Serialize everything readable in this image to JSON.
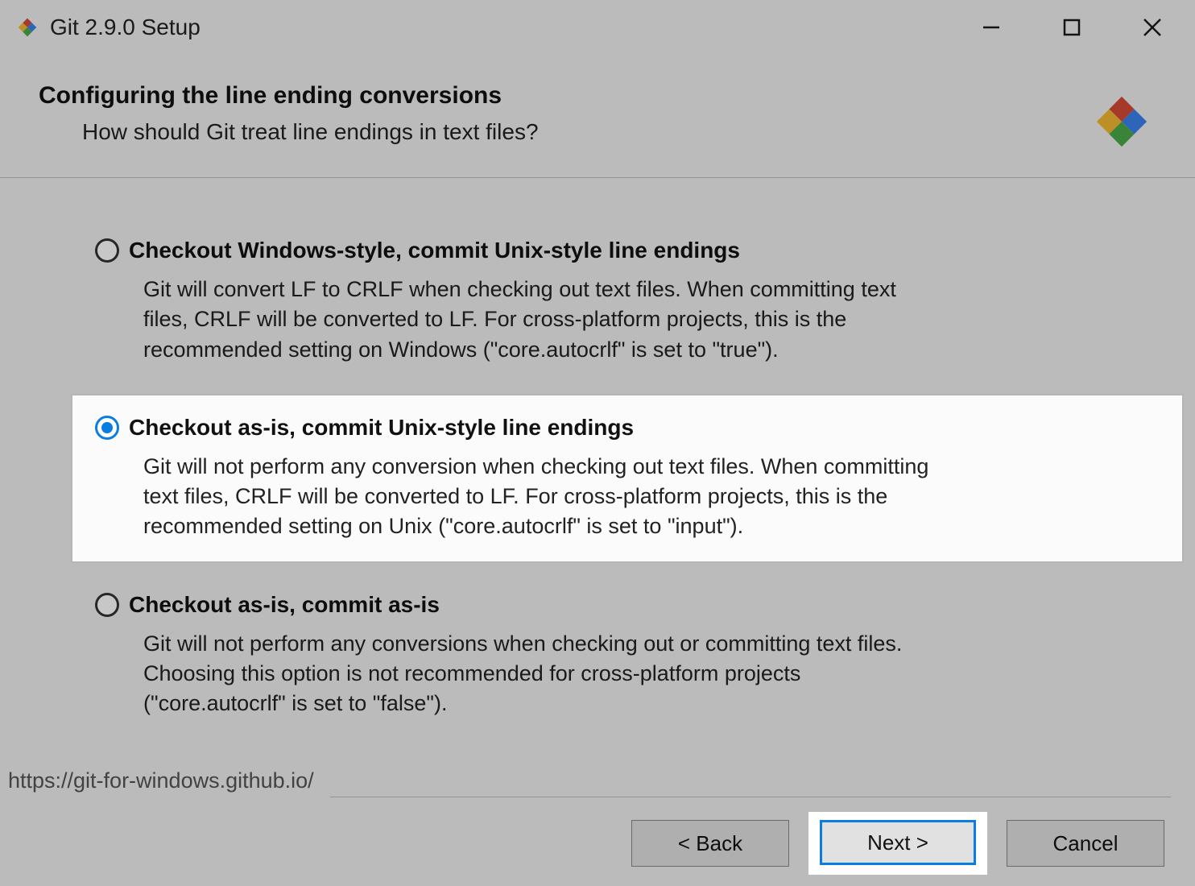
{
  "window": {
    "title": "Git 2.9.0 Setup"
  },
  "header": {
    "title": "Configuring the line ending conversions",
    "subtitle": "How should Git treat line endings in text files?"
  },
  "options": [
    {
      "label": "Checkout Windows-style, commit Unix-style line endings",
      "description": "Git will convert LF to CRLF when checking out text files. When committing text files, CRLF will be converted to LF. For cross-platform projects, this is the recommended setting on Windows (\"core.autocrlf\" is set to \"true\").",
      "checked": false
    },
    {
      "label": "Checkout as-is, commit Unix-style line endings",
      "description": "Git will not perform any conversion when checking out text files. When committing text files, CRLF will be converted to LF. For cross-platform projects, this is the recommended setting on Unix (\"core.autocrlf\" is set to \"input\").",
      "checked": true
    },
    {
      "label": "Checkout as-is, commit as-is",
      "description": "Git will not perform any conversions when checking out or committing text files. Choosing this option is not recommended for cross-platform projects (\"core.autocrlf\" is set to \"false\").",
      "checked": false
    }
  ],
  "footer": {
    "link": "https://git-for-windows.github.io/",
    "buttons": {
      "back": "< Back",
      "next": "Next >",
      "cancel": "Cancel"
    }
  }
}
